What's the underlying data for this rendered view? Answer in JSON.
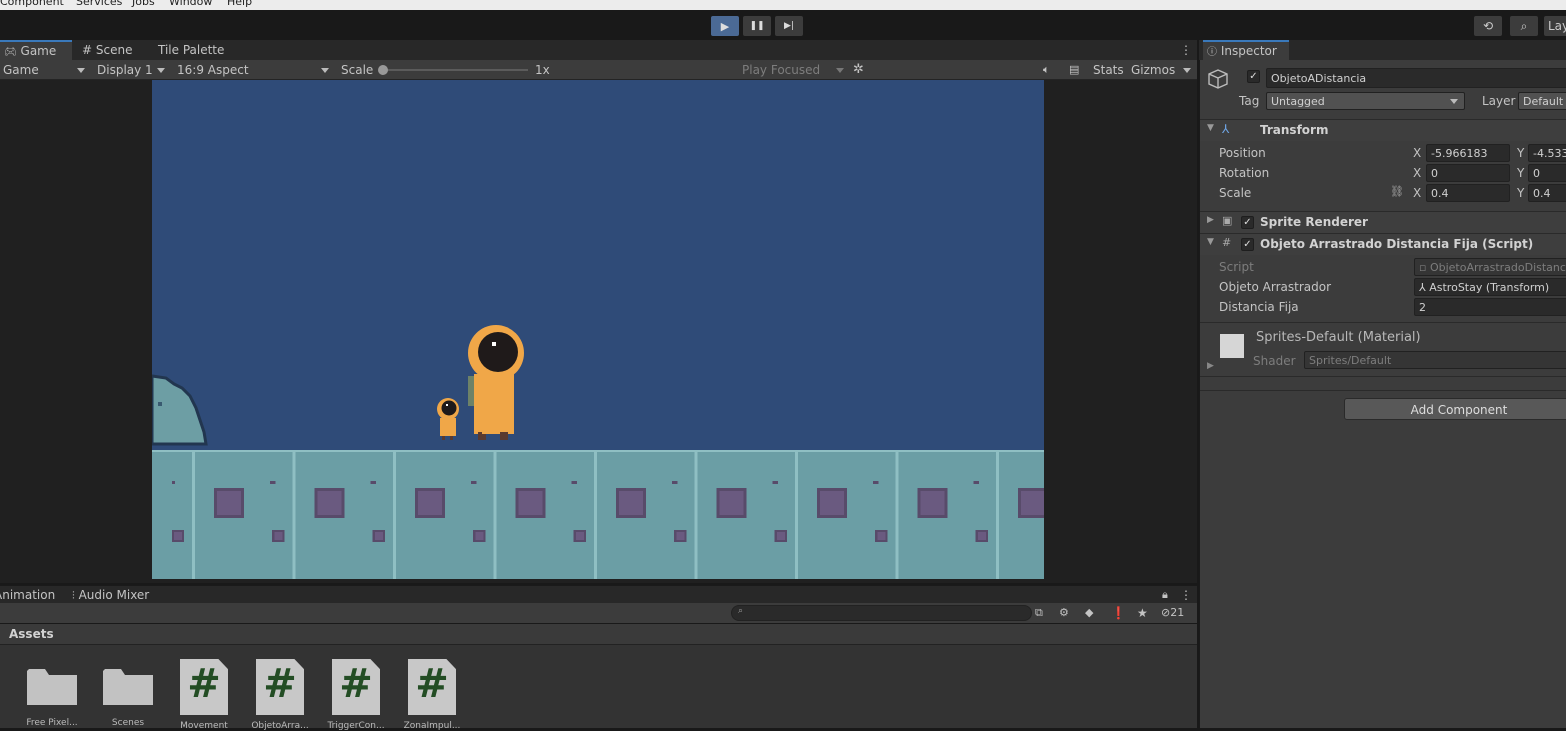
{
  "menubar": {
    "items": [
      "Component",
      "Services",
      "Jobs",
      "Window",
      "Help"
    ]
  },
  "toolbar": {
    "play": "▶",
    "pause": "❚❚",
    "step": "▶|",
    "history": "⟲",
    "search": "⌕",
    "layers": "Lay"
  },
  "game_panel": {
    "tabs": [
      "Game",
      "Scene",
      "Tile Palette"
    ],
    "mode": "Game",
    "display": "Display 1",
    "aspect": "16:9 Aspect",
    "scale_label": "Scale",
    "scale_value": "1x",
    "play_focused": "Play Focused",
    "stats": "Stats",
    "gizmos": "Gizmos"
  },
  "bottom_panel": {
    "tabs": [
      "Animation",
      "Audio Mixer"
    ],
    "hidden_count": "21",
    "breadcrumb": "Assets",
    "assets": [
      {
        "name": "Free Pixel...",
        "type": "folder"
      },
      {
        "name": "Scenes",
        "type": "folder"
      },
      {
        "name": "Movement",
        "type": "script"
      },
      {
        "name": "ObjetoArra...",
        "type": "script"
      },
      {
        "name": "TriggerCon...",
        "type": "script"
      },
      {
        "name": "ZonaImpul...",
        "type": "script"
      }
    ]
  },
  "inspector": {
    "tab": "Inspector",
    "object_name": "ObjetoADistancia",
    "tag_label": "Tag",
    "tag_value": "Untagged",
    "layer_label": "Layer",
    "layer_value": "Default",
    "transform": {
      "title": "Transform",
      "position_label": "Position",
      "rotation_label": "Rotation",
      "scale_label": "Scale",
      "position": {
        "x": "-5.966183",
        "y": "-4.533"
      },
      "rotation": {
        "x": "0",
        "y": "0"
      },
      "scale": {
        "x": "0.4",
        "y": "0.4"
      }
    },
    "sprite_renderer": "Sprite Renderer",
    "script_component": {
      "title": "Objeto Arrastrado Distancia Fija (Script)",
      "script_label": "Script",
      "script_value": "ObjetoArrastradoDistanc",
      "arrastrador_label": "Objeto Arrastrador",
      "arrastrador_value": "AstroStay (Transform)",
      "distancia_label": "Distancia Fija",
      "distancia_value": "2"
    },
    "material": {
      "name": "Sprites-Default (Material)",
      "shader_label": "Shader",
      "shader_value": "Sprites/Default"
    },
    "add_component": "Add Component"
  },
  "colors": {
    "sky": "#2f4b78",
    "ground": "#6b9ea5",
    "character": "#f0a748",
    "accent": "#3a79bb"
  }
}
